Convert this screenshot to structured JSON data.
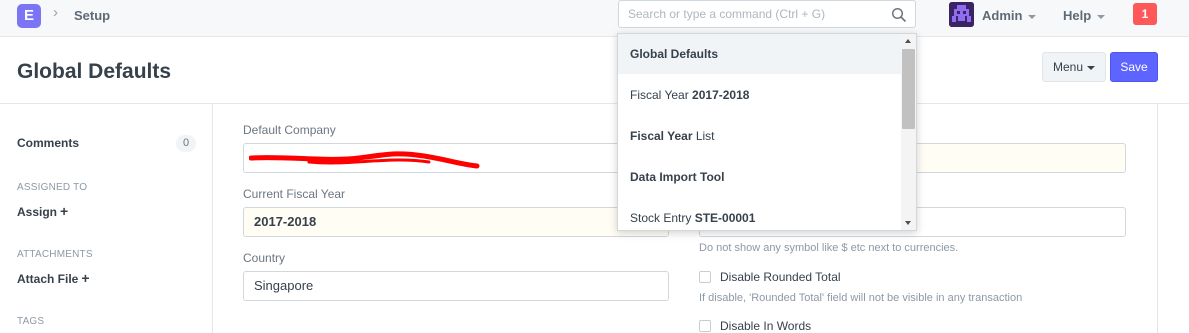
{
  "navbar": {
    "logo_letter": "E",
    "breadcrumb": "Setup",
    "search_placeholder": "Search or type a command (Ctrl + G)",
    "user_label": "Admin",
    "help_label": "Help",
    "notification_count": "1"
  },
  "page": {
    "title": "Global Defaults",
    "menu_label": "Menu",
    "save_label": "Save"
  },
  "sidebar": {
    "comments_label": "Comments",
    "comments_count": "0",
    "assigned_heading": "ASSIGNED TO",
    "assign_label": "Assign",
    "attachments_heading": "ATTACHMENTS",
    "attach_label": "Attach File",
    "tags_heading": "TAGS"
  },
  "form": {
    "default_company_label": "Default Company",
    "default_company_value": "",
    "current_fiscal_year_label": "Current Fiscal Year",
    "current_fiscal_year_value": "2017-2018",
    "country_label": "Country",
    "country_value": "Singapore",
    "currency_symbol_help": "Do not show any symbol like $ etc next to currencies.",
    "disable_rounded_total_label": "Disable Rounded Total",
    "disable_rounded_total_help": "If disable, 'Rounded Total' field will not be visible in any transaction",
    "disable_in_words_label": "Disable In Words"
  },
  "search_dropdown": {
    "items": [
      {
        "prefix": "",
        "bold": "Global Defaults",
        "suffix": ""
      },
      {
        "prefix": "Fiscal Year ",
        "bold": "2017-2018",
        "suffix": ""
      },
      {
        "prefix": "",
        "bold": "Fiscal Year",
        "suffix": " List"
      },
      {
        "prefix": "",
        "bold": "Data Import Tool",
        "suffix": ""
      },
      {
        "prefix": "Stock Entry ",
        "bold": "STE-00001",
        "suffix": ""
      }
    ]
  },
  "colors": {
    "primary": "#5e64ff",
    "logo": "#7b75f5",
    "notification": "#ff5858",
    "redaction": "#ff0000"
  }
}
